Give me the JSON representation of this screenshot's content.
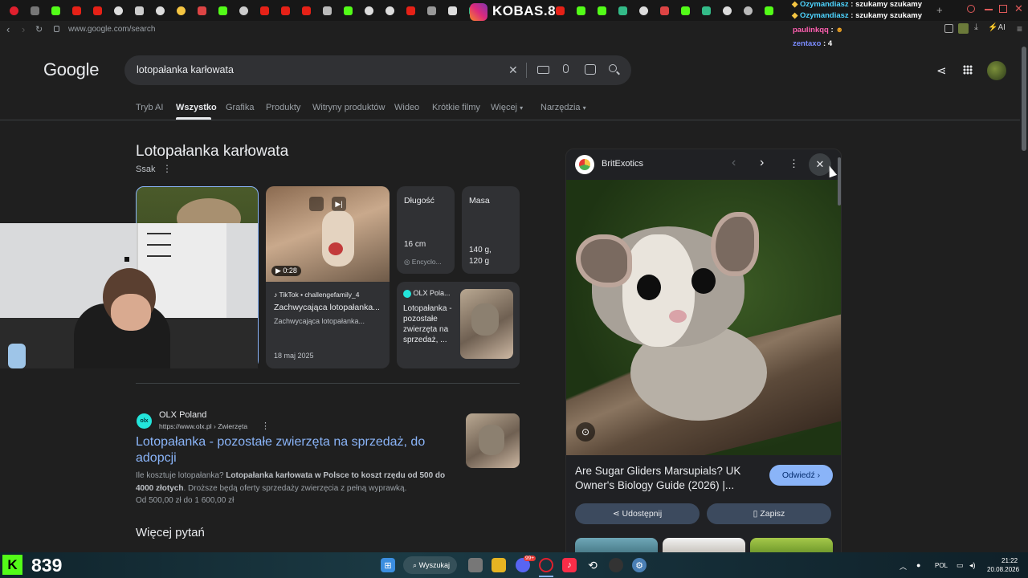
{
  "browser": {
    "active_tab_title": "KOBAS.8",
    "url": "www.google.com/search",
    "toolbar_ai_label": "AI"
  },
  "chat_overlay": {
    "lines": [
      {
        "user": "Ozymandiasz",
        "text": "szukamy szukamy"
      },
      {
        "user": "Ozymandiasz",
        "text": "szukamy szukamy"
      },
      {
        "user": "paulinkqq",
        "text": ""
      },
      {
        "user": "zentaxo",
        "text": "4"
      }
    ]
  },
  "google": {
    "logo": "Google",
    "query": "lotopałanka karłowata",
    "tabs": [
      "Tryb AI",
      "Wszystko",
      "Grafika",
      "Produkty",
      "Witryny produktów",
      "Wideo",
      "Krótkie filmy",
      "Więcej",
      "Narzędzia"
    ],
    "active_tab": "Wszystko"
  },
  "knowledge_panel": {
    "title": "Lotopałanka karłowata",
    "subtitle": "Ssak",
    "video": {
      "duration": "0:28",
      "source": "TikTok • challengefamily_4",
      "title": "Zachwycająca lotopałanka...",
      "desc": "Zachwycająca lotopałanka...",
      "date": "18 maj 2025"
    },
    "facts": [
      {
        "label": "Długość",
        "value": "16 cm",
        "source": "Encyclo..."
      },
      {
        "label": "Masa",
        "value": "140 g,\n120 g",
        "source": ""
      }
    ],
    "olx_card": {
      "source": "OLX Pola...",
      "text": "Lotopałanka - pozostałe zwierzęta na sprzedaż, ..."
    }
  },
  "result": {
    "site": "OLX Poland",
    "logo_text": "olx",
    "breadcrumb": "https://www.olx.pl › Zwierzęta",
    "title": "Lotopałanka - pozostałe zwierzęta na sprzedaż, do adopcji",
    "snippet_plain_1": "Ile kosztuje lotopałanka? ",
    "snippet_bold": "Lotopałanka karłowata w Polsce to koszt rzędu od 500 do 4000 złotych",
    "snippet_plain_2": ". Droższe będą oferty sprzedaży zwierzęcia z pełną wyprawką.",
    "price": "Od 500,00 zł do 1 600,00 zł"
  },
  "more_questions": "Więcej pytań",
  "viewer": {
    "source": "BritExotics",
    "caption": "Are Sugar Gliders Marsupials? UK Owner's Biology Guide (2026) |...",
    "visit_label": "Odwiedź",
    "share_label": "Udostępnij",
    "save_label": "Zapisz"
  },
  "taskbar": {
    "score": "839",
    "search_label": "Wyszukaj",
    "lang": "POL",
    "time": "21:22",
    "date": "20.08.2026",
    "badge": "99+"
  },
  "colors": {
    "link": "#8ab4f8",
    "page_bg": "#1f1f1f",
    "card_bg": "#303134",
    "olx": "#23e5db",
    "kick_green": "#53fc18"
  }
}
